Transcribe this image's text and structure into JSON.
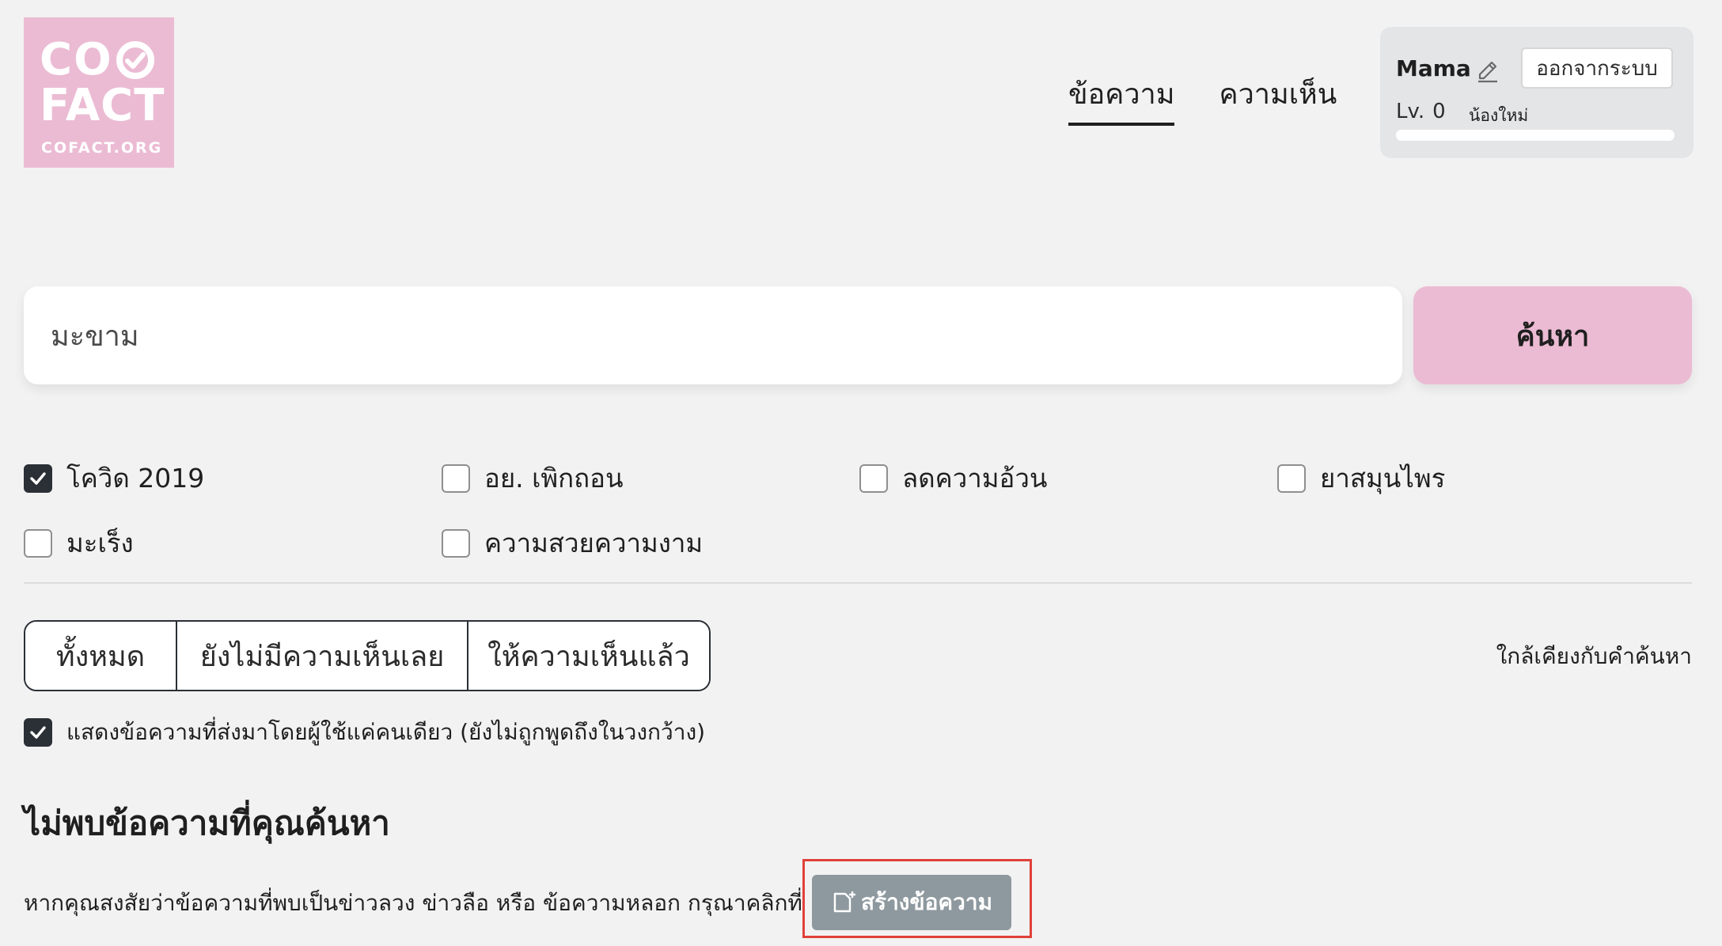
{
  "logo": {
    "line1": "CO",
    "line2": "FACT",
    "line3": "COFACT.ORG",
    "icon": "check-circle-icon"
  },
  "nav": {
    "items": [
      "ข้อความ",
      "ความเห็น"
    ],
    "active_index": 0
  },
  "user": {
    "name": "Mama",
    "edit_icon": "pencil-icon",
    "logout_label": "ออกจากระบบ",
    "level_prefix": "Lv.",
    "level_number": "0",
    "rank": "น้องใหม่",
    "progress_fraction": 0
  },
  "search": {
    "value": "มะขาม",
    "button_label": "ค้นหา"
  },
  "filters": [
    {
      "label": "โควิด 2019",
      "checked": true
    },
    {
      "label": "อย. เพิกถอน",
      "checked": false
    },
    {
      "label": "ลดความอ้วน",
      "checked": false
    },
    {
      "label": "ยาสมุนไพร",
      "checked": false
    },
    {
      "label": "มะเร็ง",
      "checked": false
    },
    {
      "label": "ความสวยความงาม",
      "checked": false
    }
  ],
  "tabs": [
    {
      "label": "ทั้งหมด",
      "active": true
    },
    {
      "label": "ยังไม่มีความเห็นเลย",
      "active": false
    },
    {
      "label": "ให้ความเห็นแล้ว",
      "active": false
    }
  ],
  "sort_label": "ใกล้เคียงกับคำค้นหา",
  "solo_filter": {
    "label": "แสดงข้อความที่ส่งมาโดยผู้ใช้แค่คนเดียว (ยังไม่ถูกพูดถึงในวงกว้าง)",
    "checked": true
  },
  "empty_state": {
    "title": "ไม่พบข้อความที่คุณค้นหา",
    "description": "หากคุณสงสัยว่าข้อความที่พบเป็นข่าวลวง ข่าวลือ หรือ ข้อความหลอก กรุณาคลิกที่",
    "create_button_label": "สร้างข้อความ",
    "create_button_icon": "new-document-icon"
  },
  "colors": {
    "brand_pink": "#ebbbd3",
    "dark": "#2b2f36",
    "background": "#f2f2f2",
    "create_button": "#8e999f",
    "highlight": "#e0413a"
  }
}
